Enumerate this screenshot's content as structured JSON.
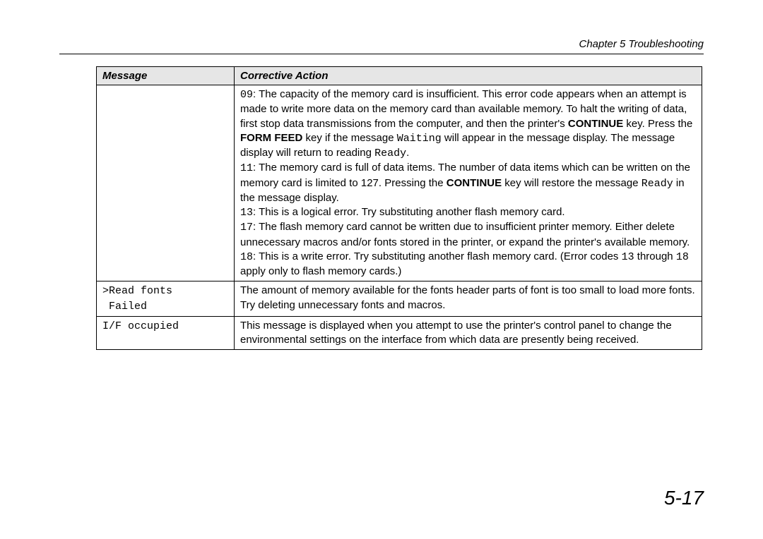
{
  "header": {
    "chapter": "Chapter 5 Troubleshooting"
  },
  "table": {
    "columns": {
      "message": "Message",
      "action": "Corrective Action"
    },
    "rows": [
      {
        "message": "",
        "action_html": "<span class=\"mono-inline\">09</span>: The capacity of the memory card is insufficient.  This error code appears when an attempt is made to write more data on the memory card than available memory.  To halt the writing of data, first stop data transmissions from the computer, and then the printer's <b>CONTINUE</b> key. Press the <b>FORM FEED</b> key if the message <span class=\"mono-inline\">Waiting</span> will appear in the message display.  The message display will return to reading <span class=\"mono-inline\">Ready</span>.<br><span class=\"mono-inline\">11</span>: The memory card is full of data items.  The number of data items which can be written on the memory card is limited to 127. Pressing the <b>CONTINUE</b> key will restore the message <span class=\"mono-inline\">Ready</span> in the message display.<br><span class=\"mono-inline\">13</span>: This is a logical error.  Try substituting another flash memory card.<br><span class=\"mono-inline\">17</span>: The flash memory card cannot be written due to insufficient printer memory.  Either delete unnecessary macros and/or fonts stored in the printer, or expand the printer's available memory.<br><span class=\"mono-inline\">18</span>: This is a write error.  Try substituting another flash memory card. (Error codes <span class=\"mono-inline\">13</span> through <span class=\"mono-inline\">18</span> apply only to flash memory cards.)"
      },
      {
        "message": ">Read fonts\n Failed",
        "action": "The amount of memory available for the fonts header parts of font is too small to load more fonts. Try deleting unnecessary fonts and macros."
      },
      {
        "message": "I/F occupied",
        "action": "This message is displayed when you attempt to use the printer's control panel to change the environmental settings on the interface from which data are presently being received."
      }
    ]
  },
  "page_number": "5-17"
}
